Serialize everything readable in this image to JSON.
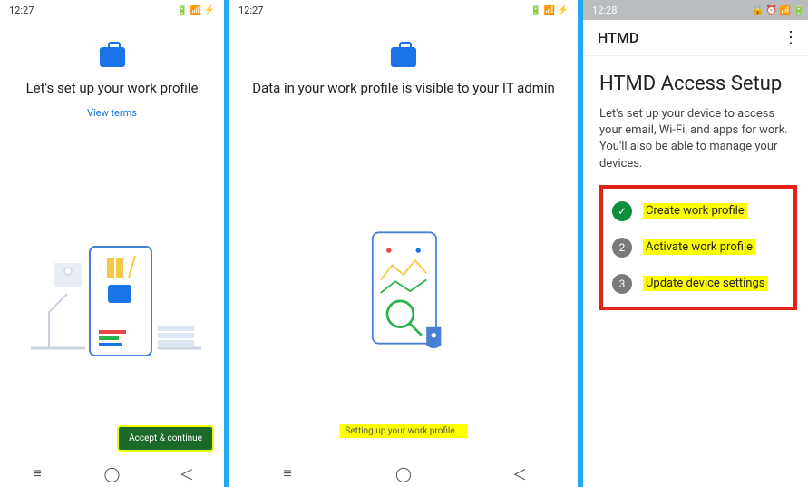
{
  "screen1": {
    "time": "12:27",
    "title": "Let's set up your work profile",
    "view_terms": "View terms",
    "accept_btn": "Accept & continue"
  },
  "screen2": {
    "time": "12:27",
    "title": "Data in your work profile is visible to your IT admin",
    "progress": "Setting up your work profile..."
  },
  "screen3": {
    "time": "12:28",
    "app_title": "HTMD",
    "heading": "HTMD Access Setup",
    "subtitle": "Let's set up your device to access your email, Wi-Fi, and apps for work. You'll also be able to manage your devices.",
    "steps": [
      {
        "num": "✓",
        "label": "Create work profile",
        "done": true
      },
      {
        "num": "2",
        "label": "Activate work profile",
        "done": false
      },
      {
        "num": "3",
        "label": "Update device settings",
        "done": false
      }
    ]
  }
}
